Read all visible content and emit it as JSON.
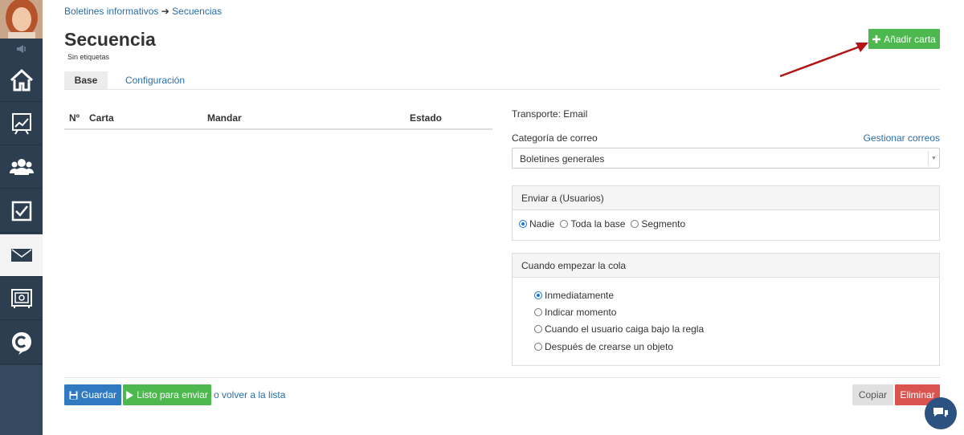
{
  "breadcrumb": {
    "parent": "Boletines informativos",
    "separator": "➔",
    "current": "Secuencias"
  },
  "page": {
    "title": "Secuencia",
    "tags": "Sin etiquetas"
  },
  "actions": {
    "add_card": "Añadir carta"
  },
  "tabs": [
    {
      "label": "Base",
      "active": true
    },
    {
      "label": "Configuración",
      "active": false
    }
  ],
  "table": {
    "columns": [
      "Nº",
      "Carta",
      "Mandar",
      "Estado"
    ]
  },
  "settings": {
    "transport": "Transporte: Email",
    "category_label": "Categoría de correo",
    "manage_link": "Gestionar correos",
    "category_value": "Boletines generales",
    "send_to": {
      "title": "Enviar a (Usuarios)",
      "options": [
        "Nadie",
        "Toda la base",
        "Segmento"
      ],
      "selected": "Nadie"
    },
    "queue_start": {
      "title": "Cuando empezar la cola",
      "options": [
        "Inmediatamente",
        "Indicar momento",
        "Cuando el usuario caiga bajo la regla",
        "Después de crearse un objeto"
      ],
      "selected": "Inmediatamente"
    }
  },
  "footer": {
    "save": "Guardar",
    "ready": "Listo para enviar",
    "back": "o volver a la lista",
    "copy": "Copiar",
    "delete": "Eliminar"
  },
  "sidebar": {
    "items": [
      {
        "icon": "home-icon"
      },
      {
        "icon": "chart-icon"
      },
      {
        "icon": "users-icon"
      },
      {
        "icon": "tasks-icon"
      },
      {
        "icon": "mail-icon",
        "active": true
      },
      {
        "icon": "safe-icon"
      },
      {
        "icon": "logo-c-icon"
      }
    ]
  },
  "colors": {
    "sidebar": "#2c3e50",
    "accent_green": "#4cb84e",
    "accent_blue": "#2f7ac0",
    "danger": "#d9534f",
    "link": "#2a6ea8"
  }
}
